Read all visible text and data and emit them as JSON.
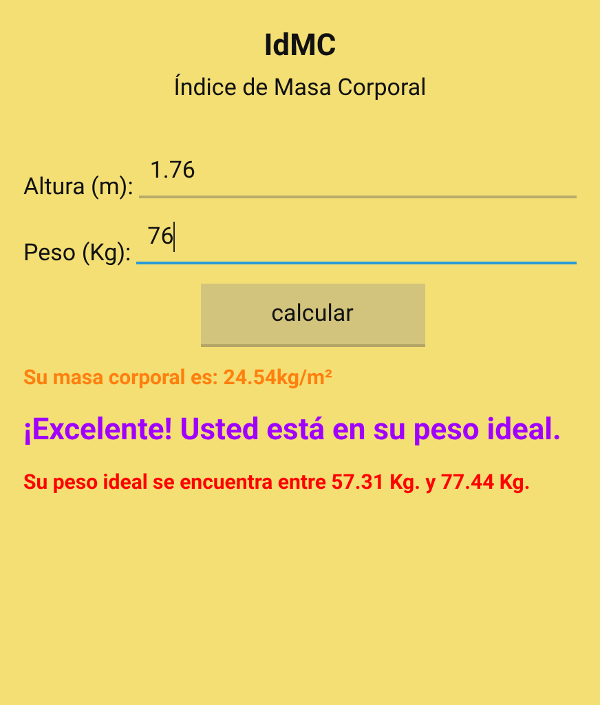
{
  "header": {
    "title": "IdMC",
    "subtitle": "Índice de Masa Corporal"
  },
  "fields": [
    {
      "label": "Altura (m):",
      "value": "1.76",
      "focused": false
    },
    {
      "label": "Peso (Kg):",
      "value": "76",
      "focused": true
    }
  ],
  "button": "calcular",
  "results": [
    {
      "text": "Su masa corporal es: 24.54kg/m²",
      "color": "#ff7f0f",
      "kind": "small"
    },
    {
      "text": "¡Excelente! Usted está en su peso ideal.",
      "color": "#a000ff",
      "kind": "large"
    },
    {
      "text": "Su peso ideal se encuentra entre 57.31 Kg. y 77.44 Kg.",
      "color": "#ff0000",
      "kind": "small"
    }
  ]
}
